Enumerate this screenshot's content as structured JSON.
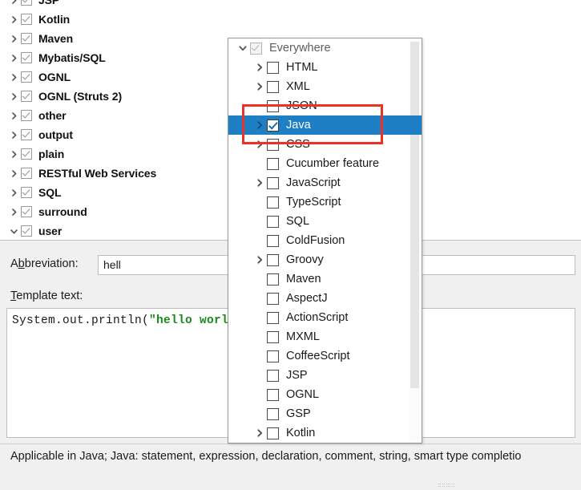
{
  "tree": {
    "rows": [
      {
        "label": "JSP",
        "expandable": true,
        "checked": true
      },
      {
        "label": "Kotlin",
        "expandable": true,
        "checked": true
      },
      {
        "label": "Maven",
        "expandable": true,
        "checked": true
      },
      {
        "label": "Mybatis/SQL",
        "expandable": true,
        "checked": true
      },
      {
        "label": "OGNL",
        "expandable": true,
        "checked": true
      },
      {
        "label": "OGNL (Struts 2)",
        "expandable": true,
        "checked": true
      },
      {
        "label": "other",
        "expandable": true,
        "checked": true
      },
      {
        "label": "output",
        "expandable": true,
        "checked": true
      },
      {
        "label": "plain",
        "expandable": true,
        "checked": true
      },
      {
        "label": "RESTful Web Services",
        "expandable": true,
        "checked": true
      },
      {
        "label": "SQL",
        "expandable": true,
        "checked": true
      },
      {
        "label": "surround",
        "expandable": true,
        "checked": true
      },
      {
        "label": "user",
        "expandable": true,
        "expanded": true,
        "checked": true
      }
    ],
    "collapsed_icon": "chevron-right-icon",
    "expanded_icon": "chevron-down-icon"
  },
  "popup": {
    "scope_rows": [
      {
        "label": "Everywhere",
        "indent": 0,
        "twisty": "down",
        "state": "disabled-checked"
      },
      {
        "label": "HTML",
        "indent": 1,
        "twisty": "right",
        "state": "off"
      },
      {
        "label": "XML",
        "indent": 1,
        "twisty": "right",
        "state": "off"
      },
      {
        "label": "JSON",
        "indent": 1,
        "twisty": "none",
        "state": "off"
      },
      {
        "label": "Java",
        "indent": 1,
        "twisty": "right",
        "state": "on",
        "selected": true
      },
      {
        "label": "CSS",
        "indent": 1,
        "twisty": "right",
        "state": "off"
      },
      {
        "label": "Cucumber feature",
        "indent": 1,
        "twisty": "none",
        "state": "off"
      },
      {
        "label": "JavaScript",
        "indent": 1,
        "twisty": "right",
        "state": "off"
      },
      {
        "label": "TypeScript",
        "indent": 1,
        "twisty": "none",
        "state": "off"
      },
      {
        "label": "SQL",
        "indent": 1,
        "twisty": "none",
        "state": "off"
      },
      {
        "label": "ColdFusion",
        "indent": 1,
        "twisty": "none",
        "state": "off"
      },
      {
        "label": "Groovy",
        "indent": 1,
        "twisty": "right",
        "state": "off"
      },
      {
        "label": "Maven",
        "indent": 1,
        "twisty": "none",
        "state": "off"
      },
      {
        "label": "AspectJ",
        "indent": 1,
        "twisty": "none",
        "state": "off"
      },
      {
        "label": "ActionScript",
        "indent": 1,
        "twisty": "none",
        "state": "off"
      },
      {
        "label": "MXML",
        "indent": 1,
        "twisty": "none",
        "state": "off"
      },
      {
        "label": "CoffeeScript",
        "indent": 1,
        "twisty": "none",
        "state": "off"
      },
      {
        "label": "JSP",
        "indent": 1,
        "twisty": "none",
        "state": "off"
      },
      {
        "label": "OGNL",
        "indent": 1,
        "twisty": "none",
        "state": "off"
      },
      {
        "label": "GSP",
        "indent": 1,
        "twisty": "none",
        "state": "off"
      },
      {
        "label": "Kotlin",
        "indent": 1,
        "twisty": "right",
        "state": "off"
      }
    ]
  },
  "form": {
    "abbreviation_label_pre": "A",
    "abbreviation_label_mnemonic": "b",
    "abbreviation_label_post": "breviation:",
    "abbreviation_value": "hell",
    "template_label_mnemonic": "T",
    "template_label_post": "emplate text:",
    "code_prefix": "System.out.println(",
    "code_string": "\"hello world\"",
    "code_suffix": ")"
  },
  "status": {
    "text": "Applicable in Java; Java: statement, expression, declaration, comment, string, smart type completio"
  },
  "annotation": {
    "highlight_color": "#ef3124",
    "selection_color": "#1e7fc4"
  }
}
